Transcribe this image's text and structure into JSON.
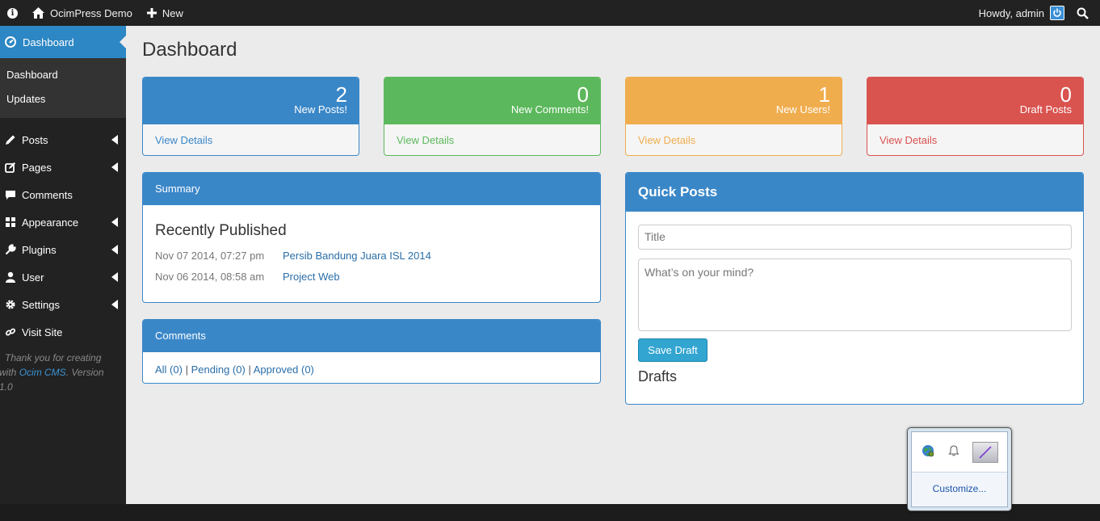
{
  "topbar": {
    "site_name": "OcimPress Demo",
    "new_label": "New",
    "greeting": "Howdy, admin"
  },
  "sidebar": {
    "active": "Dashboard",
    "subitems": [
      "Dashboard",
      "Updates"
    ],
    "items": [
      {
        "label": "Posts",
        "icon": "pencil-icon",
        "has_caret": true
      },
      {
        "label": "Pages",
        "icon": "edit-icon",
        "has_caret": true
      },
      {
        "label": "Comments",
        "icon": "comment-icon",
        "has_caret": false
      },
      {
        "label": "Appearance",
        "icon": "grid-icon",
        "has_caret": true
      },
      {
        "label": "Plugins",
        "icon": "wrench-icon",
        "has_caret": true
      },
      {
        "label": "User",
        "icon": "user-icon",
        "has_caret": true
      },
      {
        "label": "Settings",
        "icon": "gear-icon",
        "has_caret": true
      },
      {
        "label": "Visit Site",
        "icon": "link-icon",
        "has_caret": false
      }
    ],
    "footer": {
      "text1": "Thank you for creating",
      "text2": "with ",
      "link": "Ocim CMS",
      "text3": ". Version",
      "text4": "1.0"
    }
  },
  "main": {
    "title": "Dashboard",
    "stats": [
      {
        "count": "2",
        "label": "New Posts!",
        "link": "View Details",
        "color": "#3a87c8"
      },
      {
        "count": "0",
        "label": "New Comments!",
        "link": "View Details",
        "color": "#5cb85c"
      },
      {
        "count": "1",
        "label": "New Users!",
        "link": "View Details",
        "color": "#f0ad4e"
      },
      {
        "count": "0",
        "label": "Draft Posts",
        "link": "View Details",
        "color": "#d9534f"
      }
    ],
    "summary": {
      "header": "Summary",
      "title": "Recently Published",
      "rows": [
        {
          "date": "Nov 07 2014, 07:27 pm",
          "title": "Persib Bandung Juara ISL 2014"
        },
        {
          "date": "Nov 06 2014, 08:58 am",
          "title": "Project Web"
        }
      ]
    },
    "comments": {
      "header": "Comments",
      "all": "All (0)",
      "pending": "Pending (0)",
      "approved": "Approved (0)",
      "sep": "|"
    },
    "quick_posts": {
      "header": "Quick Posts",
      "title_placeholder": "Title",
      "body_placeholder": "What’s on your mind?",
      "save_label": "Save Draft",
      "drafts_label": "Drafts"
    }
  },
  "tray": {
    "customize_label": "Customize..."
  }
}
